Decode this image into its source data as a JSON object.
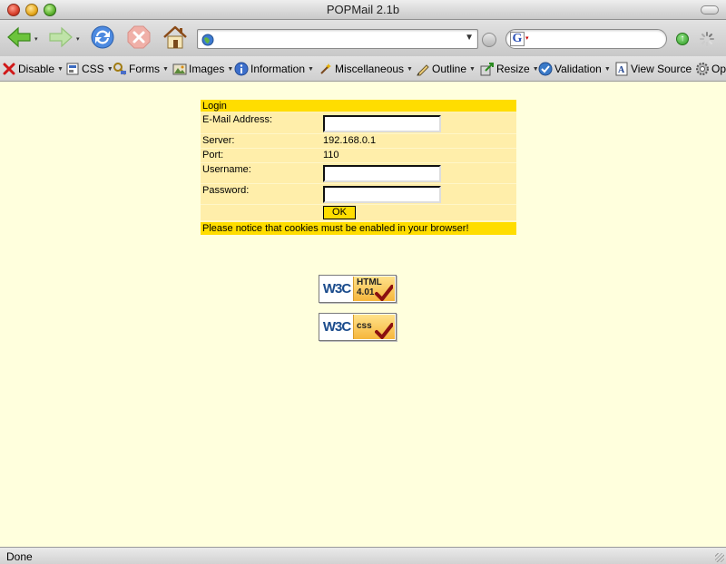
{
  "window": {
    "title": "POPMail 2.1b"
  },
  "navbar": {
    "back_icon": "back-arrow-icon",
    "forward_icon": "forward-arrow-icon",
    "reload_icon": "reload-icon",
    "stop_icon": "stop-icon",
    "home_icon": "home-icon",
    "url_value": "",
    "search_value": "",
    "search_engine_letter": "G"
  },
  "devbar": {
    "items": [
      {
        "label": "Disable",
        "icon": "disable-icon"
      },
      {
        "label": "CSS",
        "icon": "css-icon"
      },
      {
        "label": "Forms",
        "icon": "forms-icon"
      },
      {
        "label": "Images",
        "icon": "images-icon"
      },
      {
        "label": "Information",
        "icon": "information-icon"
      },
      {
        "label": "Miscellaneous",
        "icon": "miscellaneous-icon"
      },
      {
        "label": "Outline",
        "icon": "outline-icon"
      },
      {
        "label": "Resize",
        "icon": "resize-icon"
      },
      {
        "label": "Validation",
        "icon": "validation-icon"
      },
      {
        "label": "View Source",
        "icon": "view-source-icon"
      },
      {
        "label": "Opt",
        "icon": "options-icon"
      }
    ]
  },
  "login": {
    "heading": "Login",
    "email_label": "E-Mail Address:",
    "email_value": "",
    "server_label": "Server:",
    "server_value": "192.168.0.1",
    "port_label": "Port:",
    "port_value": "110",
    "username_label": "Username:",
    "username_value": "",
    "password_label": "Password:",
    "password_value": "",
    "ok_label": "OK",
    "notice": "Please notice that cookies must be enabled in your browser!"
  },
  "badges": {
    "html": {
      "logo": "W3C",
      "line1": "HTML",
      "line2": "4.01"
    },
    "css": {
      "logo": "W3C",
      "line1": "css"
    }
  },
  "statusbar": {
    "text": "Done"
  },
  "colors": {
    "page_bg": "#ffffdd",
    "login_header": "#ffdd00",
    "login_row": "#ffeeaa"
  }
}
